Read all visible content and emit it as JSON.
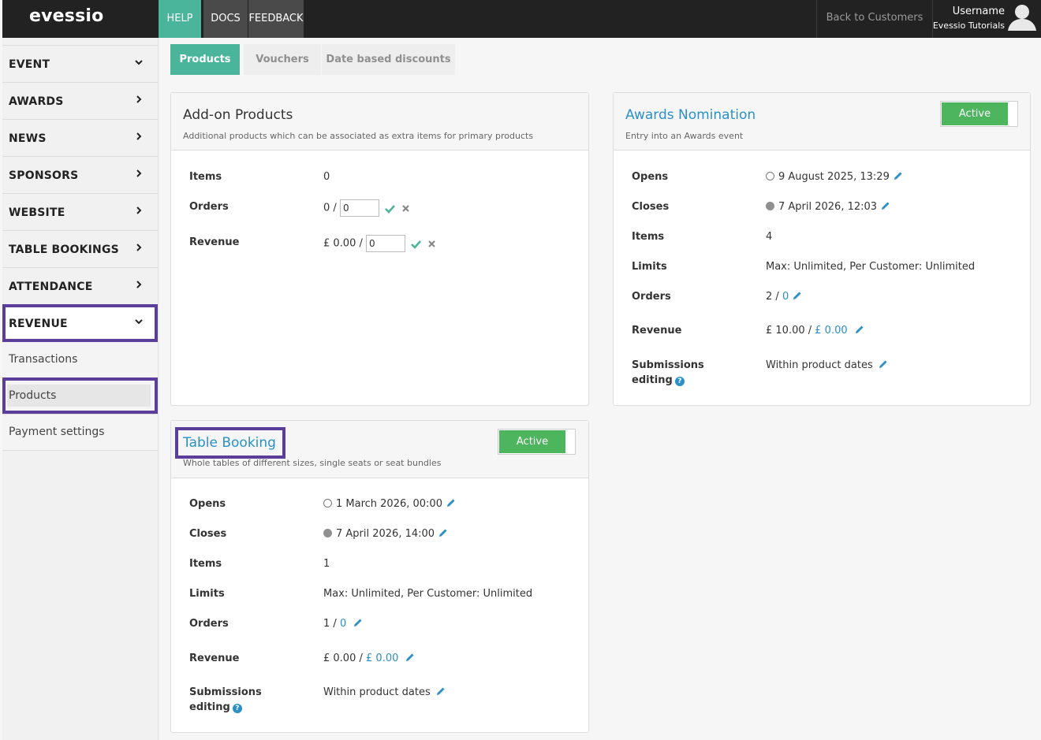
{
  "brand": {
    "logo": "evessio",
    "accent": "#4ab59a",
    "highlight": "#5b3d9a",
    "active_green": "#4cb55d",
    "link_blue": "#2a90c7"
  },
  "topnav": {
    "help": "HELP",
    "docs": "DOCS",
    "feedback": "FEEDBACK",
    "back": "Back to Customers",
    "username": "Username",
    "org": "Evessio Tutorials"
  },
  "sidebar": {
    "items": [
      {
        "label": "EVENT",
        "chevron": "chevron-down-icon"
      },
      {
        "label": "AWARDS",
        "chevron": "chevron-right-icon"
      },
      {
        "label": "NEWS",
        "chevron": "chevron-right-icon"
      },
      {
        "label": "SPONSORS",
        "chevron": "chevron-right-icon"
      },
      {
        "label": "WEBSITE",
        "chevron": "chevron-right-icon"
      },
      {
        "label": "TABLE BOOKINGS",
        "chevron": "chevron-right-icon"
      },
      {
        "label": "ATTENDANCE",
        "chevron": "chevron-right-icon"
      },
      {
        "label": "REVENUE",
        "chevron": "chevron-down-icon"
      }
    ],
    "sub": [
      {
        "label": "Transactions"
      },
      {
        "label": "Products"
      },
      {
        "label": "Payment settings"
      }
    ]
  },
  "tabs": [
    {
      "label": "Products"
    },
    {
      "label": "Vouchers"
    },
    {
      "label": "Date based discounts"
    }
  ],
  "addon": {
    "title": "Add-on Products",
    "subtitle": "Additional products which can be associated as extra items for primary products",
    "items_label": "Items",
    "items_value": "0",
    "orders_label": "Orders",
    "orders_prefix": "0 /",
    "orders_input": "0",
    "revenue_label": "Revenue",
    "revenue_prefix": "£ 0.00 /",
    "revenue_input": "0"
  },
  "awards": {
    "title": "Awards Nomination",
    "subtitle": "Entry into an Awards event",
    "toggle": "Active",
    "opens_label": "Opens",
    "opens_value": "9 August 2025, 13:29",
    "closes_label": "Closes",
    "closes_value": "7 April 2026, 12:03",
    "items_label": "Items",
    "items_value": "4",
    "limits_label": "Limits",
    "limits_value": "Max: Unlimited, Per Customer: Unlimited",
    "orders_label": "Orders",
    "orders_count": "2 /",
    "orders_limit": "0",
    "revenue_label": "Revenue",
    "revenue_amount": "£ 10.00 /",
    "revenue_limit": "£ 0.00",
    "subm_label_1": "Submissions",
    "subm_label_2": "editing",
    "subm_value": "Within product dates"
  },
  "table": {
    "title": "Table Booking",
    "subtitle": "Whole tables of different sizes, single seats or seat bundles",
    "toggle": "Active",
    "opens_label": "Opens",
    "opens_value": "1 March 2026, 00:00",
    "closes_label": "Closes",
    "closes_value": "7 April 2026, 14:00",
    "items_label": "Items",
    "items_value": "1",
    "limits_label": "Limits",
    "limits_value": "Max: Unlimited, Per Customer: Unlimited",
    "orders_label": "Orders",
    "orders_count": "1 /",
    "orders_limit": "0",
    "revenue_label": "Revenue",
    "revenue_amount": "£ 0.00 /",
    "revenue_limit": "£ 0.00",
    "subm_label_1": "Submissions",
    "subm_label_2": "editing",
    "subm_value": "Within product dates"
  }
}
